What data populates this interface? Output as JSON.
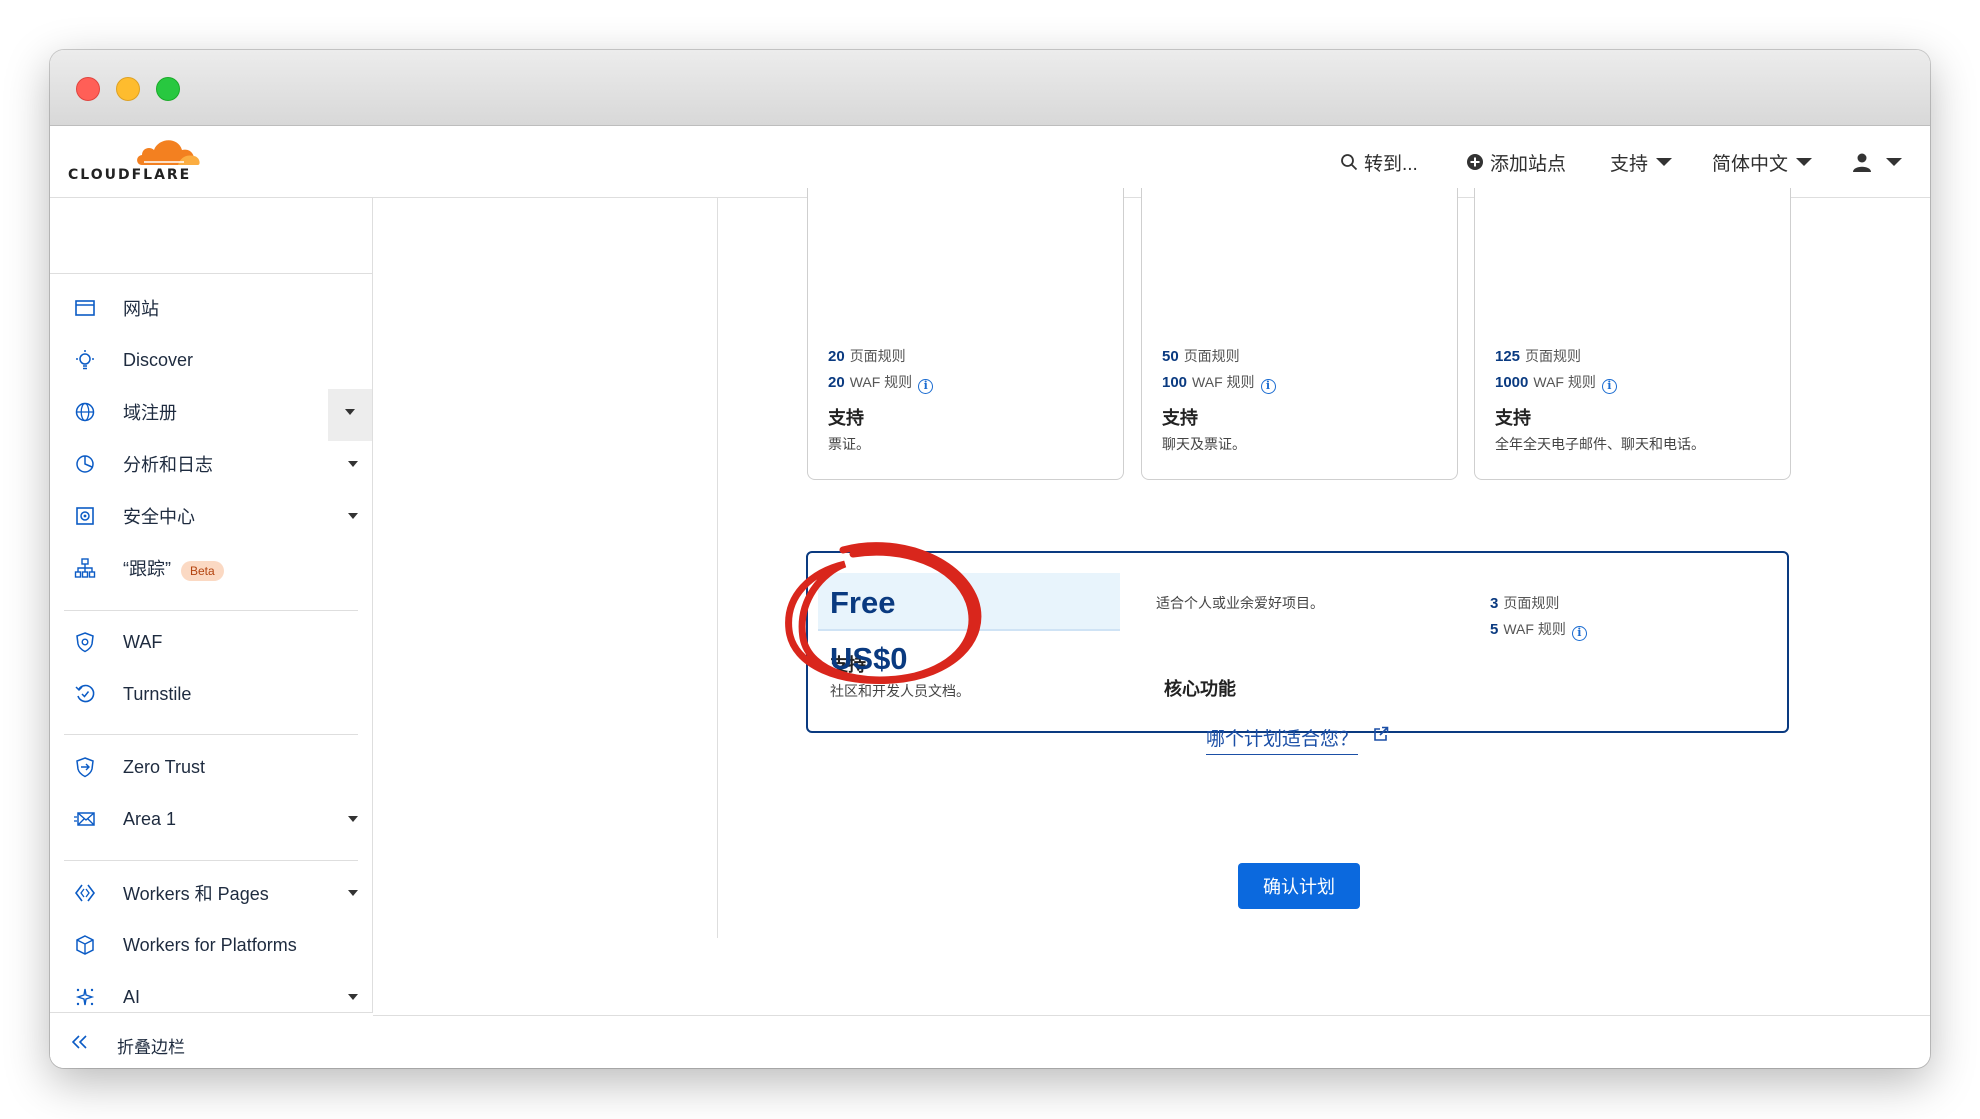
{
  "topnav": {
    "logo_text": "CLOUDFLARE",
    "goto": "转到...",
    "add_site": "添加站点",
    "support": "支持",
    "language": "简体中文"
  },
  "sidebar": {
    "items": [
      {
        "label": "网站",
        "icon": "browser-window-icon"
      },
      {
        "label": "Discover",
        "icon": "lightbulb-icon"
      },
      {
        "label": "域注册",
        "icon": "globe-icon"
      },
      {
        "label": "分析和日志",
        "icon": "pie-chart-icon"
      },
      {
        "label": "安全中心",
        "icon": "security-center-icon"
      },
      {
        "label": "“跟踪”",
        "icon": "network-tree-icon",
        "badge": "Beta"
      },
      {
        "label": "WAF",
        "icon": "shield-gear-icon"
      },
      {
        "label": "Turnstile",
        "icon": "turnstile-icon"
      },
      {
        "label": "Zero Trust",
        "icon": "zero-trust-icon"
      },
      {
        "label": "Area 1",
        "icon": "mail-icon"
      },
      {
        "label": "Workers 和 Pages",
        "icon": "workers-icon"
      },
      {
        "label": "Workers for Platforms",
        "icon": "cube-icon"
      },
      {
        "label": "AI",
        "icon": "sparkle-icon"
      }
    ],
    "collapse": "折叠边栏"
  },
  "plans": [
    {
      "page_rules_count": "20",
      "page_rules_label": "页面规则",
      "waf_count": "20",
      "waf_label": "WAF 规则",
      "support_title": "支持",
      "support_desc": "票证。"
    },
    {
      "page_rules_count": "50",
      "page_rules_label": "页面规则",
      "waf_count": "100",
      "waf_label": "WAF 规则",
      "support_title": "支持",
      "support_desc": "聊天及票证。"
    },
    {
      "page_rules_count": "125",
      "page_rules_label": "页面规则",
      "waf_count": "1000",
      "waf_label": "WAF 规则",
      "support_title": "支持",
      "support_desc": "全年全天电子邮件、聊天和电话。"
    }
  ],
  "free_plan": {
    "name": "Free",
    "price": "US$0",
    "support_title": "支持",
    "support_desc": "社区和开发人员文档。",
    "desc": "适合个人或业余爱好项目。",
    "core": "核心功能",
    "page_rules_count": "3",
    "page_rules_label": "页面规则",
    "waf_count": "5",
    "waf_label": "WAF 规则"
  },
  "which_plan_link": "哪个计划适合您？",
  "confirm_button": "确认计划",
  "colors": {
    "accent": "#0b69de",
    "navy": "#0a3a80",
    "annotation": "#d9261c",
    "brand_orange": "#f38020"
  }
}
